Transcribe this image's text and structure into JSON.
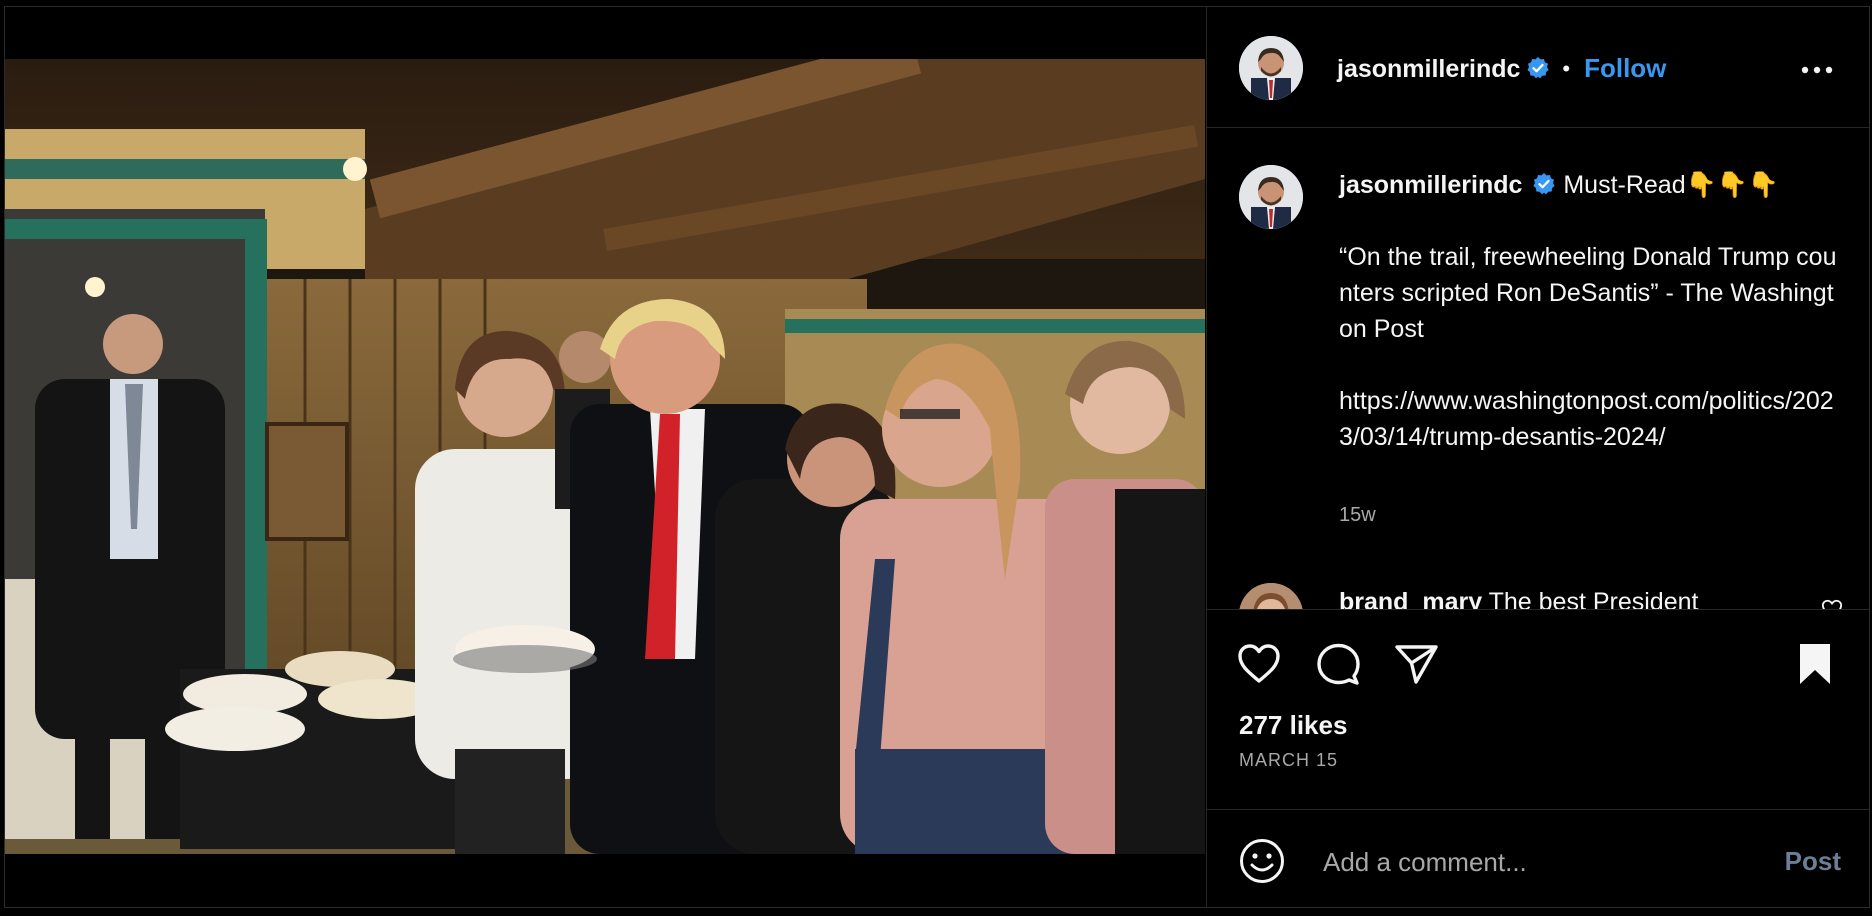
{
  "post": {
    "author": {
      "username": "jasonmillerindc",
      "verified": true,
      "follow_label": "Follow",
      "separator": "•"
    },
    "caption": {
      "username": "jasonmillerindc",
      "intro": "Must-Read👇👇👇",
      "quote": "“On the trail, freewheeling Donald Trump counters scripted Ron DeSantis” - The Washington Post",
      "link": "https://www.washingtonpost.com/politics/2023/03/14/trump-desantis-2024/",
      "time_ago": "15w"
    },
    "comments": [
      {
        "username": "brand_mary",
        "text": "The best President"
      }
    ],
    "likes_text": "277 likes",
    "date_text": "MARCH 15",
    "comment_box": {
      "placeholder": "Add a comment...",
      "post_label": "Post"
    }
  },
  "icons": {
    "verified": "verified-badge-icon",
    "more": "more-options-icon",
    "like": "heart-icon",
    "comment": "comment-bubble-icon",
    "share": "paper-plane-icon",
    "save": "bookmark-icon",
    "emoji": "emoji-icon"
  },
  "colors": {
    "background": "#000000",
    "text_primary": "#f5f5f5",
    "text_secondary": "#a8a8a8",
    "accent": "#3897f0",
    "verified": "#3897f0",
    "divider": "#262626"
  }
}
